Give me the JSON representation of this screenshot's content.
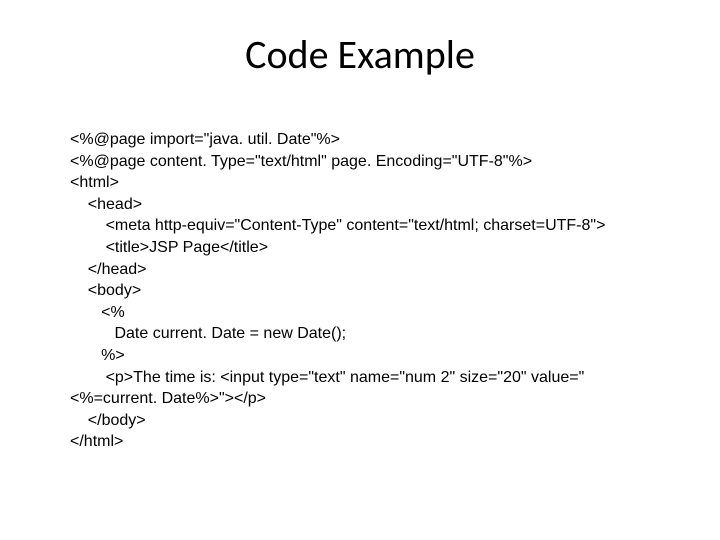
{
  "title": "Code Example",
  "code": {
    "l1": "<%@page import=\"java. util. Date\"%>",
    "l2": "<%@page content. Type=\"text/html\" page. Encoding=\"UTF-8\"%>",
    "l3": "<html>",
    "l4": "    <head>",
    "l5": "        <meta http-equiv=\"Content-Type\" content=\"text/html; charset=UTF-8\">",
    "l6": "        <title>JSP Page</title>",
    "l7": "    </head>",
    "l8": "    <body>",
    "l9": "       <%",
    "l10": "          Date current. Date = new Date();",
    "l11": "       %>",
    "l12": "        <p>The time is: <input type=\"text\" name=\"num 2\" size=\"20\" value=\"<%=current. Date%>\"></p>",
    "l13": "    </body>",
    "l14": "</html>"
  }
}
